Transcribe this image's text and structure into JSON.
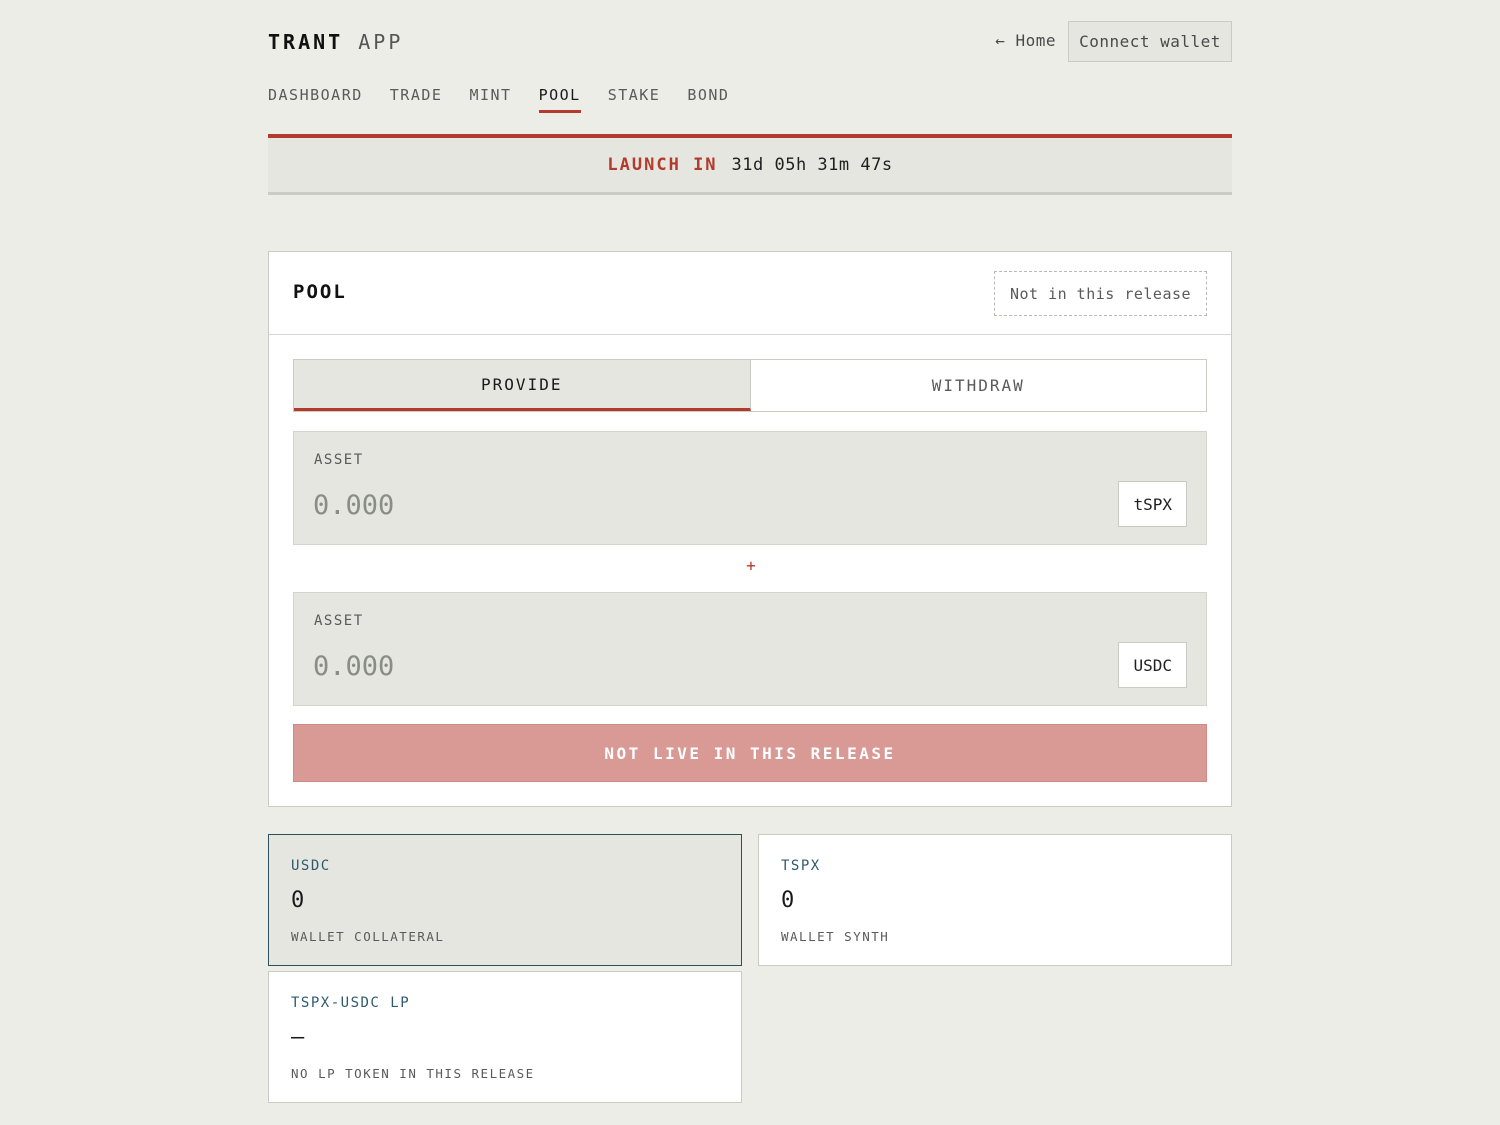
{
  "header": {
    "brand_bold": "TRANT",
    "brand_light": "APP",
    "home_link": "← Home",
    "connect_wallet": "Connect wallet"
  },
  "nav": {
    "items": [
      "DASHBOARD",
      "TRADE",
      "MINT",
      "POOL",
      "STAKE",
      "BOND"
    ],
    "active": "POOL"
  },
  "banner": {
    "label": "LAUNCH IN",
    "countdown": "31d 05h 31m 47s"
  },
  "pool": {
    "title": "POOL",
    "tag": "Not in this release",
    "tabs": [
      "PROVIDE",
      "WITHDRAW"
    ],
    "active_tab": "PROVIDE",
    "asset1": {
      "label": "ASSET",
      "placeholder": "0.000",
      "token": "tSPX"
    },
    "separator": "+",
    "asset2": {
      "label": "ASSET",
      "placeholder": "0.000",
      "token": "USDC"
    },
    "action_button": "NOT LIVE IN THIS RELEASE"
  },
  "stats": [
    {
      "name": "USDC",
      "value": "0",
      "sub": "WALLET COLLATERAL"
    },
    {
      "name": "TSPX",
      "value": "0",
      "sub": "WALLET SYNTH"
    },
    {
      "name": "TSPX-USDC LP",
      "value": "—",
      "sub": "NO LP TOKEN IN THIS RELEASE"
    }
  ],
  "colors": {
    "accent": "#b33a2c",
    "background": "#ecede7",
    "panel": "#e4e6df",
    "disabled_button": "#d99a95",
    "stat_label": "#2e5a70"
  }
}
